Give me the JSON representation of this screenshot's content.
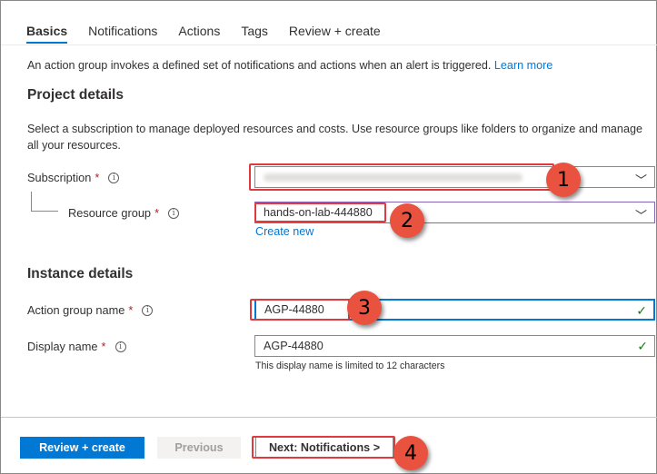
{
  "tabs": [
    {
      "label": "Basics",
      "active": true
    },
    {
      "label": "Notifications",
      "active": false
    },
    {
      "label": "Actions",
      "active": false
    },
    {
      "label": "Tags",
      "active": false
    },
    {
      "label": "Review + create",
      "active": false
    }
  ],
  "intro": {
    "text": "An action group invokes a defined set of notifications and actions when an alert is triggered.",
    "link": "Learn more"
  },
  "project_details": {
    "title": "Project details",
    "description": "Select a subscription to manage deployed resources and costs. Use resource groups like folders to organize and manage all your resources.",
    "subscription_label": "Subscription",
    "resource_group_label": "Resource group",
    "resource_group_value": "hands-on-lab-444880",
    "create_new": "Create new"
  },
  "instance_details": {
    "title": "Instance details",
    "action_group_name_label": "Action group name",
    "action_group_name_value": "AGP-44880",
    "display_name_label": "Display name",
    "display_name_value": "AGP-44880",
    "display_name_hint": "This display name is limited to 12 characters"
  },
  "common": {
    "required_marker": "*",
    "info_glyph": "i",
    "chevron_glyph": "﹀",
    "check_glyph": "✓"
  },
  "footer": {
    "review_create": "Review + create",
    "previous": "Previous",
    "next": "Next: Notifications >"
  },
  "callouts": [
    "1",
    "2",
    "3",
    "4"
  ],
  "colors": {
    "accent": "#0078d4",
    "required": "#a4262c",
    "valid": "#107c10",
    "callout": "#e8523f",
    "highlight": "#e03a3e"
  }
}
